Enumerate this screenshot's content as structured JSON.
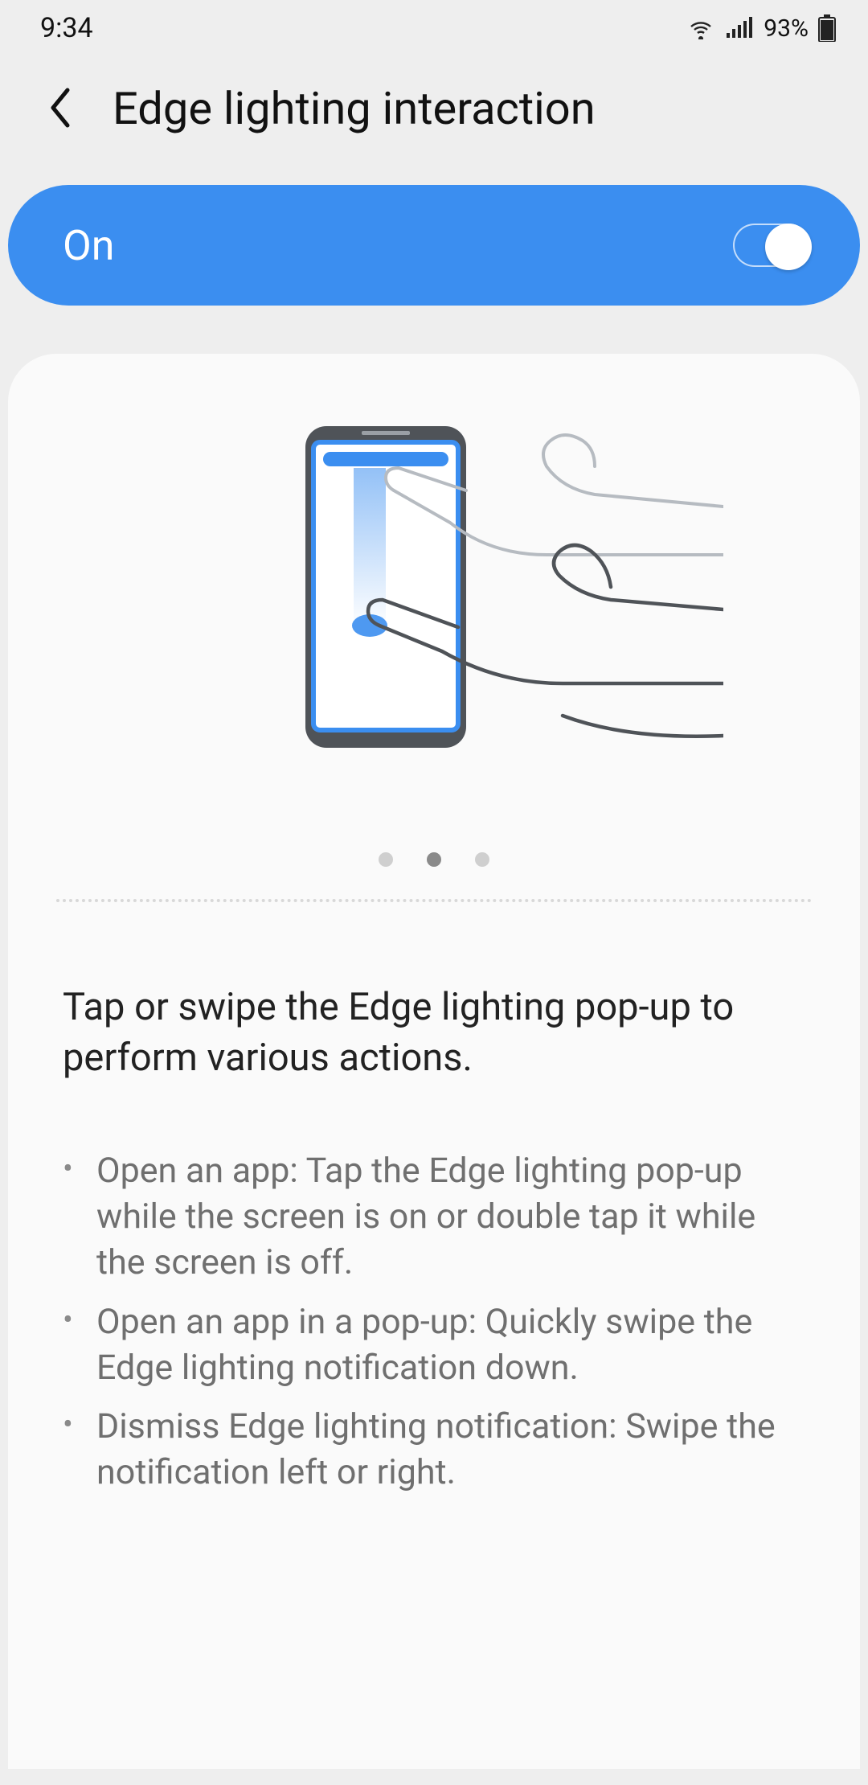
{
  "status": {
    "time": "9:34",
    "battery_pct": "93%"
  },
  "header": {
    "title": "Edge lighting interaction"
  },
  "master_toggle": {
    "label": "On",
    "state": true
  },
  "pager": {
    "count": 3,
    "active_index": 1
  },
  "description": {
    "lead": "Tap or swipe the Edge lighting pop-up to perform various actions.",
    "bullets": [
      "Open an app: Tap the Edge lighting pop-up while the screen is on or double tap it while the screen is off.",
      "Open an app in a pop-up: Quickly swipe the Edge lighting notification down.",
      "Dismiss Edge lighting notification: Swipe the notification left or right."
    ]
  },
  "colors": {
    "accent": "#3b8ef0"
  }
}
